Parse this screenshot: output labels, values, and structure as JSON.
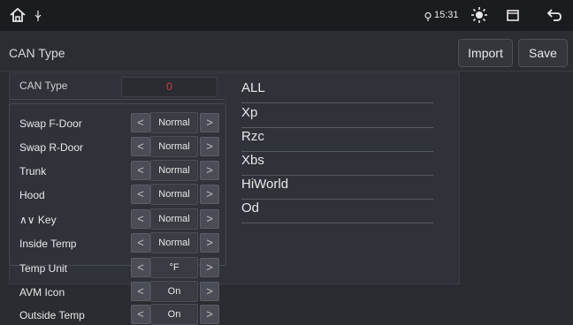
{
  "status_bar": {
    "home_icon": "home-icon",
    "usb_icon": "usb-icon",
    "location_icon": "location-icon",
    "time": "15:31",
    "brightness_icon": "brightness-icon",
    "window_icon": "window-icon",
    "back_icon": "back-icon"
  },
  "header": {
    "title": "CAN Type",
    "import_label": "Import",
    "save_label": "Save"
  },
  "can_type": {
    "label": "CAN Type",
    "value": "0"
  },
  "can_list": [
    "ALL",
    "Xp",
    "Rzc",
    "Xbs",
    "HiWorld",
    "Od"
  ],
  "settings": [
    {
      "label": "Swap F-Door",
      "value": "Normal"
    },
    {
      "label": "Swap R-Door",
      "value": "Normal"
    },
    {
      "label": "Trunk",
      "value": "Normal"
    },
    {
      "label": "Hood",
      "value": "Normal"
    },
    {
      "label": "∧∨ Key",
      "value": "Normal"
    },
    {
      "label": "Inside Temp",
      "value": "Normal"
    },
    {
      "label": "Temp Unit",
      "value": "°F"
    },
    {
      "label": "AVM Icon",
      "value": "On"
    },
    {
      "label": "Outside Temp",
      "value": "On"
    }
  ],
  "arrows": {
    "left": "<",
    "right": ">"
  },
  "colors": {
    "accent_red": "#d23b3b",
    "background": "#2a2c31"
  }
}
